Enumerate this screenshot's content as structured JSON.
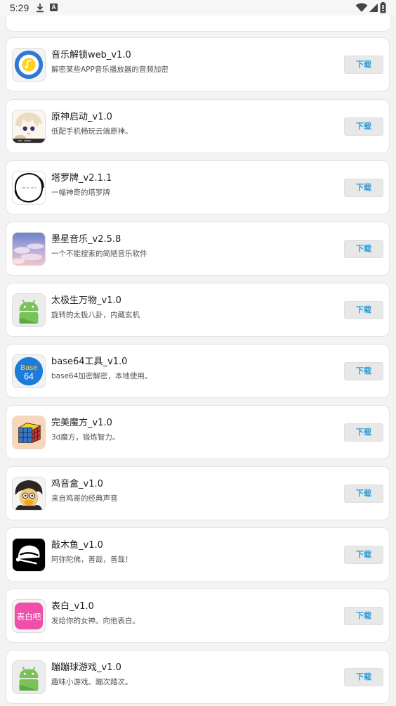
{
  "status_bar": {
    "time": "5:29"
  },
  "download_label": "下载",
  "apps": [
    {
      "name": "音乐解锁web_v1.0",
      "desc": "解密某些APP音乐播放器的音频加密",
      "icon": "music-unlock-icon"
    },
    {
      "name": "原神启动_v1.0",
      "desc": "低配手机畅玩云端原神。",
      "icon": "genshin-character-icon"
    },
    {
      "name": "塔罗牌_v2.1.1",
      "desc": "一幅神奇的塔罗牌",
      "icon": "tarot-circle-icon"
    },
    {
      "name": "墨星音乐_v2.5.8",
      "desc": "一个不能搜索的简陋音乐软件",
      "icon": "sky-clouds-icon"
    },
    {
      "name": "太极生万物_v1.0",
      "desc": "旋转的太极八卦，内藏玄机",
      "icon": "android-robot-icon"
    },
    {
      "name": "base64工具_v1.0",
      "desc": "base64加密解密，本地使用。",
      "icon": "base64-icon",
      "icon_text": [
        "Base",
        "64"
      ]
    },
    {
      "name": "完美魔方_v1.0",
      "desc": "3d魔方，锻炼智力。",
      "icon": "rubiks-cube-icon"
    },
    {
      "name": "鸡音盒_v1.0",
      "desc": "来自鸡哥的经典声音",
      "icon": "chicken-avatar-icon"
    },
    {
      "name": "敲木鱼_v1.0",
      "desc": "阿弥陀佛，善哉，善哉！",
      "icon": "wooden-fish-icon"
    },
    {
      "name": "表白_v1.0",
      "desc": "发给你的女神。向他表白。",
      "icon": "confession-icon",
      "icon_text": "表白吧"
    },
    {
      "name": "蹦蹦球游戏_v1.0",
      "desc": "趣味小游戏。蹦次踏次。",
      "icon": "android-robot-icon"
    }
  ]
}
